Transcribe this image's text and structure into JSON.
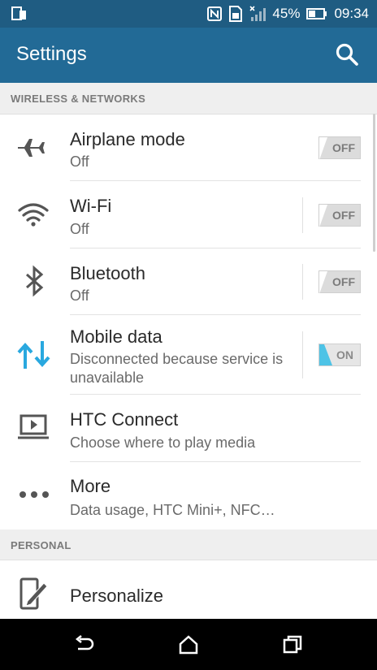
{
  "status_bar": {
    "battery_percent": "45%",
    "time": "09:34",
    "icons": [
      "screen-mirror-icon",
      "nfc-icon",
      "sim-icon",
      "no-signal-icon",
      "battery-icon"
    ]
  },
  "app_bar": {
    "title": "Settings",
    "search_icon": "search-icon"
  },
  "sections": [
    {
      "header": "WIRELESS & NETWORKS",
      "items": [
        {
          "title": "Airplane mode",
          "summary": "Off",
          "icon": "airplane-icon",
          "toggle": "OFF"
        },
        {
          "title": "Wi-Fi",
          "summary": "Off",
          "icon": "wifi-icon",
          "toggle": "OFF"
        },
        {
          "title": "Bluetooth",
          "summary": "Off",
          "icon": "bluetooth-icon",
          "toggle": "OFF"
        },
        {
          "title": "Mobile data",
          "summary_line1": "Disconnected because service is",
          "summary_line2": "unavailable",
          "icon": "mobile-data-icon",
          "toggle": "ON"
        },
        {
          "title": "HTC Connect",
          "summary": "Choose where to play media",
          "icon": "htc-connect-icon"
        },
        {
          "title": "More",
          "summary": "Data usage, HTC Mini+, NFC…",
          "icon": "more-dots-icon"
        }
      ]
    },
    {
      "header": "PERSONAL",
      "items": [
        {
          "title": "Personalize",
          "icon": "personalize-icon"
        }
      ]
    }
  ],
  "nav_bar": {
    "buttons": [
      "back-icon",
      "home-icon",
      "recents-icon"
    ]
  },
  "colors": {
    "status_bar": "#1f5c82",
    "app_bar": "#226a96",
    "accent_on": "#4ec3e6",
    "section_bg": "#efefef"
  }
}
